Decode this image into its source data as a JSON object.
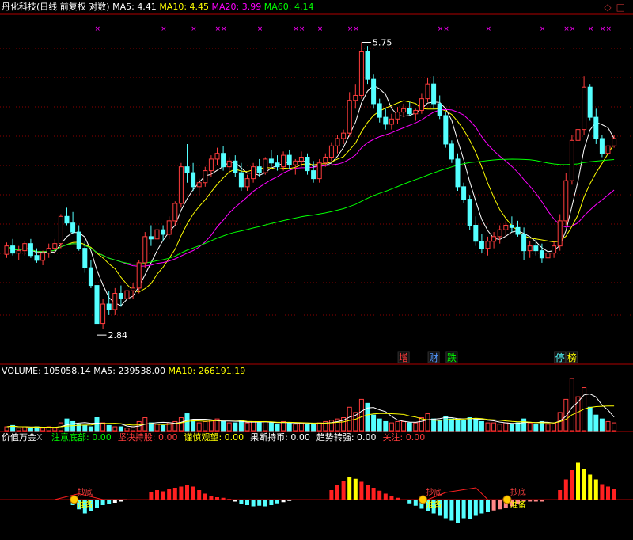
{
  "colors": {
    "bg": "#000000",
    "up": "#ff3c3c",
    "down": "#54ffff",
    "ma5": "#ffffff",
    "ma10": "#ffff00",
    "ma20": "#ff00ff",
    "ma60": "#00ff00",
    "grid": "#8b0000",
    "label_white": "#ffffff"
  },
  "header": {
    "title": "丹化科技(日线 前复权 对数)",
    "ma5_label": "MA5:",
    "ma5_value": "4.41",
    "ma10_label": "MA10:",
    "ma10_value": "4.45",
    "ma20_label": "MA20:",
    "ma20_value": "3.99",
    "ma60_label": "MA60:",
    "ma60_value": "4.14"
  },
  "corner_icons": [
    "diamond-icon",
    "square-icon"
  ],
  "price_labels": {
    "high": "5.75",
    "low": "2.84"
  },
  "event_markers": [
    {
      "text": "增",
      "color": "#ff3c3c"
    },
    {
      "text": "财",
      "color": "#5599ff"
    },
    {
      "text": "跌",
      "color": "#00ff00"
    },
    {
      "text": "停",
      "color": "#54ffff"
    },
    {
      "text": "榜",
      "color": "#ffff00"
    }
  ],
  "volume_header": {
    "label": "VOLUME:",
    "value": "105058.14",
    "ma5_label": "MA5:",
    "ma5_value": "239538.00",
    "ma10_label": "MA10:",
    "ma10_value": "266191.19"
  },
  "indicator_header": {
    "name": "价值万金",
    "close_glyph": "X",
    "items": [
      {
        "label": "注意底部:",
        "value": "0.00",
        "color": "#00ff00"
      },
      {
        "label": "坚决持股:",
        "value": "0.00",
        "color": "#ff3c3c"
      },
      {
        "label": "谨慎观望:",
        "value": "0.00",
        "color": "#ffff00"
      },
      {
        "label": "果断持币:",
        "value": "0.00",
        "color": "#ffffff"
      },
      {
        "label": "趋势转强:",
        "value": "0.00",
        "color": "#ffffff"
      },
      {
        "label": "关注:",
        "value": "0.00",
        "color": "#ff3c3c"
      }
    ],
    "signal_labels": [
      "抄底",
      "准备"
    ]
  },
  "chart_data": {
    "type": "candlestick",
    "scale": "log",
    "candles": [
      [
        3.45,
        3.55,
        3.42,
        3.52
      ],
      [
        3.52,
        3.58,
        3.44,
        3.46
      ],
      [
        3.46,
        3.52,
        3.4,
        3.48
      ],
      [
        3.48,
        3.56,
        3.44,
        3.54
      ],
      [
        3.54,
        3.58,
        3.42,
        3.44
      ],
      [
        3.44,
        3.5,
        3.38,
        3.4
      ],
      [
        3.4,
        3.48,
        3.36,
        3.46
      ],
      [
        3.46,
        3.54,
        3.42,
        3.5
      ],
      [
        3.5,
        3.58,
        3.46,
        3.54
      ],
      [
        3.54,
        3.8,
        3.5,
        3.78
      ],
      [
        3.78,
        3.86,
        3.7,
        3.72
      ],
      [
        3.72,
        3.82,
        3.62,
        3.64
      ],
      [
        3.64,
        3.7,
        3.48,
        3.5
      ],
      [
        3.5,
        3.56,
        3.3,
        3.34
      ],
      [
        3.34,
        3.4,
        3.18,
        3.2
      ],
      [
        3.2,
        3.26,
        2.84,
        2.92
      ],
      [
        2.92,
        3.1,
        2.88,
        3.06
      ],
      [
        3.06,
        3.16,
        2.98,
        3.02
      ],
      [
        3.02,
        3.18,
        2.98,
        3.14
      ],
      [
        3.14,
        3.2,
        3.04,
        3.1
      ],
      [
        3.1,
        3.2,
        3.06,
        3.16
      ],
      [
        3.16,
        3.22,
        3.1,
        3.18
      ],
      [
        3.18,
        3.4,
        3.14,
        3.38
      ],
      [
        3.38,
        3.64,
        3.34,
        3.6
      ],
      [
        3.6,
        3.7,
        3.52,
        3.58
      ],
      [
        3.58,
        3.72,
        3.54,
        3.66
      ],
      [
        3.66,
        3.7,
        3.56,
        3.62
      ],
      [
        3.62,
        3.78,
        3.58,
        3.74
      ],
      [
        3.74,
        3.92,
        3.7,
        3.9
      ],
      [
        3.9,
        4.3,
        3.86,
        4.26
      ],
      [
        4.26,
        4.5,
        4.1,
        4.2
      ],
      [
        4.2,
        4.3,
        4.02,
        4.06
      ],
      [
        4.06,
        4.14,
        3.98,
        4.1
      ],
      [
        4.1,
        4.26,
        4.06,
        4.22
      ],
      [
        4.22,
        4.38,
        4.16,
        4.34
      ],
      [
        4.34,
        4.46,
        4.28,
        4.4
      ],
      [
        4.4,
        4.48,
        4.22,
        4.26
      ],
      [
        4.26,
        4.36,
        4.2,
        4.32
      ],
      [
        4.32,
        4.38,
        4.16,
        4.2
      ],
      [
        4.2,
        4.3,
        4.02,
        4.06
      ],
      [
        4.06,
        4.18,
        4.02,
        4.14
      ],
      [
        4.14,
        4.3,
        4.1,
        4.26
      ],
      [
        4.26,
        4.34,
        4.16,
        4.2
      ],
      [
        4.2,
        4.36,
        4.18,
        4.34
      ],
      [
        4.34,
        4.44,
        4.26,
        4.3
      ],
      [
        4.3,
        4.38,
        4.22,
        4.26
      ],
      [
        4.26,
        4.42,
        4.22,
        4.38
      ],
      [
        4.38,
        4.44,
        4.24,
        4.28
      ],
      [
        4.28,
        4.34,
        4.18,
        4.32
      ],
      [
        4.32,
        4.42,
        4.26,
        4.36
      ],
      [
        4.36,
        4.4,
        4.18,
        4.22
      ],
      [
        4.22,
        4.32,
        4.1,
        4.14
      ],
      [
        4.14,
        4.34,
        4.1,
        4.3
      ],
      [
        4.3,
        4.4,
        4.26,
        4.36
      ],
      [
        4.36,
        4.52,
        4.32,
        4.48
      ],
      [
        4.48,
        4.6,
        4.4,
        4.56
      ],
      [
        4.56,
        4.66,
        4.5,
        4.62
      ],
      [
        4.62,
        5.1,
        4.58,
        5.0
      ],
      [
        5.0,
        5.2,
        4.9,
        5.06
      ],
      [
        5.06,
        5.75,
        5.02,
        5.62
      ],
      [
        5.62,
        5.7,
        5.2,
        5.26
      ],
      [
        5.26,
        5.32,
        4.9,
        4.96
      ],
      [
        4.96,
        5.02,
        4.74,
        4.8
      ],
      [
        4.8,
        4.9,
        4.66,
        4.72
      ],
      [
        4.72,
        4.84,
        4.66,
        4.78
      ],
      [
        4.78,
        4.92,
        4.72,
        4.86
      ],
      [
        4.86,
        4.96,
        4.8,
        4.9
      ],
      [
        4.9,
        4.98,
        4.82,
        4.84
      ],
      [
        4.84,
        4.9,
        4.76,
        4.88
      ],
      [
        4.88,
        5.08,
        4.84,
        5.02
      ],
      [
        5.02,
        5.28,
        4.98,
        5.2
      ],
      [
        5.2,
        5.3,
        4.9,
        4.96
      ],
      [
        4.96,
        5.06,
        4.78,
        4.82
      ],
      [
        4.82,
        4.86,
        4.46,
        4.5
      ],
      [
        4.5,
        4.54,
        4.3,
        4.34
      ],
      [
        4.34,
        4.4,
        4.02,
        4.06
      ],
      [
        4.06,
        4.1,
        3.9,
        3.94
      ],
      [
        3.94,
        3.98,
        3.66,
        3.7
      ],
      [
        3.7,
        3.78,
        3.52,
        3.56
      ],
      [
        3.56,
        3.62,
        3.46,
        3.5
      ],
      [
        3.5,
        3.6,
        3.44,
        3.56
      ],
      [
        3.56,
        3.64,
        3.5,
        3.6
      ],
      [
        3.6,
        3.7,
        3.54,
        3.66
      ],
      [
        3.66,
        3.74,
        3.6,
        3.7
      ],
      [
        3.7,
        3.78,
        3.64,
        3.68
      ],
      [
        3.68,
        3.74,
        3.6,
        3.62
      ],
      [
        3.62,
        3.68,
        3.4,
        3.48
      ],
      [
        3.48,
        3.56,
        3.42,
        3.52
      ],
      [
        3.52,
        3.58,
        3.44,
        3.48
      ],
      [
        3.48,
        3.54,
        3.38,
        3.42
      ],
      [
        3.42,
        3.5,
        3.4,
        3.46
      ],
      [
        3.46,
        3.56,
        3.42,
        3.52
      ],
      [
        3.52,
        3.8,
        3.48,
        3.74
      ],
      [
        3.74,
        4.2,
        3.7,
        4.12
      ],
      [
        4.12,
        4.6,
        4.08,
        4.54
      ],
      [
        4.54,
        4.7,
        4.5,
        4.66
      ],
      [
        4.66,
        5.3,
        4.6,
        5.16
      ],
      [
        5.16,
        5.2,
        4.76,
        4.8
      ],
      [
        4.8,
        4.9,
        4.5,
        4.56
      ],
      [
        4.56,
        4.6,
        4.36,
        4.4
      ],
      [
        4.4,
        4.52,
        4.36,
        4.48
      ],
      [
        4.48,
        4.6,
        4.46,
        4.56
      ]
    ],
    "volume": [
      3,
      4,
      2,
      3,
      2,
      3,
      2,
      3,
      2,
      6,
      9,
      7,
      5,
      4,
      3,
      10,
      6,
      4,
      3,
      3,
      2,
      3,
      7,
      10,
      6,
      5,
      4,
      6,
      7,
      10,
      13,
      8,
      6,
      7,
      8,
      9,
      7,
      6,
      6,
      8,
      6,
      7,
      6,
      7,
      6,
      5,
      7,
      6,
      5,
      6,
      5,
      5,
      6,
      7,
      8,
      9,
      10,
      18,
      14,
      24,
      21,
      12,
      9,
      7,
      6,
      7,
      7,
      6,
      6,
      10,
      13,
      9,
      8,
      11,
      9,
      9,
      8,
      10,
      9,
      7,
      6,
      6,
      5,
      6,
      5,
      6,
      9,
      6,
      5,
      7,
      5,
      6,
      14,
      24,
      40,
      26,
      33,
      18,
      12,
      9,
      7,
      6
    ],
    "indicator": [
      0,
      0,
      0,
      0,
      0,
      0,
      0,
      0,
      0,
      0,
      0,
      -0.08,
      -0.15,
      -0.22,
      -0.18,
      -0.12,
      -0.08,
      -0.06,
      -0.04,
      -0.02,
      0,
      0,
      0,
      0,
      0.12,
      0.16,
      0.14,
      0.18,
      0.2,
      0.22,
      0.24,
      0.22,
      0.16,
      0.1,
      0.06,
      0.04,
      0.03,
      0.01,
      -0.02,
      -0.06,
      -0.08,
      -0.1,
      -0.09,
      -0.1,
      -0.08,
      -0.05,
      -0.03,
      -0.01,
      0,
      0,
      0,
      0,
      0,
      0,
      0.16,
      0.24,
      0.32,
      0.38,
      0.35,
      0.3,
      0.25,
      0.2,
      0.15,
      0.1,
      0.06,
      0.03,
      0,
      -0.05,
      -0.09,
      -0.14,
      -0.18,
      -0.22,
      -0.26,
      -0.3,
      -0.34,
      -0.38,
      -0.3,
      -0.32,
      -0.26,
      -0.22,
      -0.2,
      -0.17,
      -0.15,
      -0.12,
      -0.1,
      -0.06,
      -0.02,
      -0.02,
      -0.02,
      -0.02,
      0,
      0,
      0.16,
      0.34,
      0.5,
      0.62,
      0.52,
      0.42,
      0.34,
      0.26,
      0.22,
      0.18
    ]
  }
}
